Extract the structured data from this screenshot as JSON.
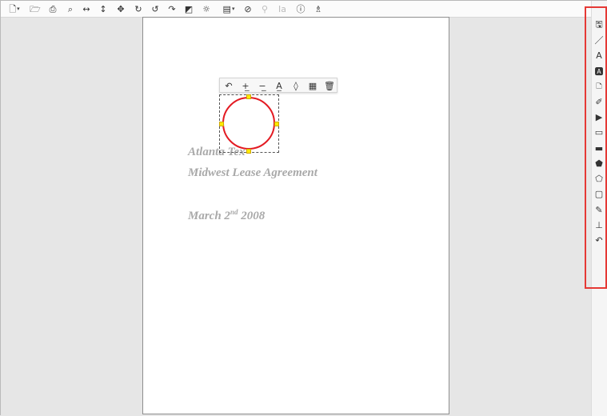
{
  "toolbar": {
    "items": [
      {
        "name": "new-document-icon",
        "glyph": "🗋",
        "dropdown": true
      },
      {
        "name": "open-folder-icon",
        "glyph": "🗁"
      },
      {
        "name": "print-icon",
        "glyph": "⎙"
      },
      {
        "name": "zoom-fit-icon",
        "glyph": "⌕"
      },
      {
        "name": "fit-width-icon",
        "glyph": "↔"
      },
      {
        "name": "fit-height-icon",
        "glyph": "↕"
      },
      {
        "name": "pan-move-icon",
        "glyph": "✥"
      },
      {
        "name": "rotate-clockwise-icon",
        "glyph": "↻"
      },
      {
        "name": "rotate-counterclockwise-icon",
        "glyph": "↺"
      },
      {
        "name": "redo-icon",
        "glyph": "↷"
      },
      {
        "name": "crop-icon",
        "glyph": "◩"
      },
      {
        "name": "brightness-icon",
        "glyph": "☼"
      },
      {
        "name": "image-settings-icon",
        "glyph": "▤",
        "dropdown": true
      },
      {
        "name": "hide-annotations-icon",
        "glyph": "⊘"
      },
      {
        "name": "search-icon",
        "glyph": "⚲",
        "disabled": true
      },
      {
        "name": "ocr-text-icon",
        "glyph": "Ia",
        "disabled": true
      },
      {
        "name": "info-icon",
        "glyph": "ⓘ"
      },
      {
        "name": "hierarchy-icon",
        "glyph": "♗"
      }
    ]
  },
  "document": {
    "line1": "Atlanta Tex",
    "line2": "Midwest Lease Agreement",
    "line3_main": "March 2",
    "line3_sup": "nd",
    "line3_year": " 2008"
  },
  "annotation_toolbar": {
    "items": [
      {
        "name": "undo-annotation-icon",
        "glyph": "↶"
      },
      {
        "name": "increase-line-width-icon",
        "glyph": "+̲"
      },
      {
        "name": "decrease-line-width-icon",
        "glyph": "−̲"
      },
      {
        "name": "text-color-icon",
        "glyph": "A̲"
      },
      {
        "name": "fill-color-icon",
        "glyph": "◊"
      },
      {
        "name": "properties-icon",
        "glyph": "▦"
      },
      {
        "name": "delete-annotation-icon",
        "glyph": "🗑"
      }
    ]
  },
  "right_tools": {
    "items": [
      {
        "name": "save-annotations-icon",
        "glyph": "🖫"
      },
      {
        "name": "line-tool-icon",
        "glyph": "／"
      },
      {
        "name": "text-tool-icon",
        "glyph": "A"
      },
      {
        "name": "text-box-tool-icon",
        "glyph": "🅰"
      },
      {
        "name": "sticky-note-tool-icon",
        "glyph": "🗅"
      },
      {
        "name": "highlighter-tool-icon",
        "glyph": "✐"
      },
      {
        "name": "redaction-tool-icon",
        "glyph": "▶"
      },
      {
        "name": "rectangle-outline-tool-icon",
        "glyph": "▭"
      },
      {
        "name": "filled-rectangle-tool-icon",
        "glyph": "▬"
      },
      {
        "name": "filled-polygon-tool-icon",
        "glyph": "⬟"
      },
      {
        "name": "polygon-tool-icon",
        "glyph": "⬠"
      },
      {
        "name": "rounded-rectangle-tool-icon",
        "glyph": "▢"
      },
      {
        "name": "freehand-pen-tool-icon",
        "glyph": "✎"
      },
      {
        "name": "stamp-tool-icon",
        "glyph": "⊥"
      },
      {
        "name": "undo-tool-icon",
        "glyph": "↶"
      }
    ]
  }
}
